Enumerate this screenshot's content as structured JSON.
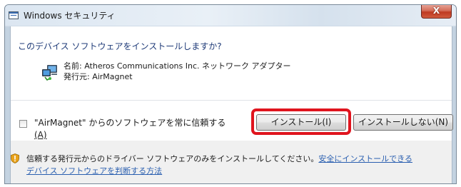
{
  "window": {
    "title": "Windows セキュリティ",
    "close_glyph": "X"
  },
  "prompt": "このデバイス ソフトウェアをインストールしますか?",
  "details": {
    "name": "名前: Atheros Communications Inc. ネットワーク アダプター",
    "publisher": "発行元: AirMagnet"
  },
  "trust": {
    "checked": false,
    "label_main": "\"AirMagnet\" からのソフトウェアを常に信頼する",
    "label_access": "(A)"
  },
  "buttons": {
    "install": "インストール(I)",
    "dont_install": "インストールしない(N)"
  },
  "warning": {
    "text": "信頼する発行元からのドライバー ソフトウェアのみをインストールしてください。",
    "link_part1": "安全にインストールできる",
    "link_part2": "デバイス ソフトウェアを判断する方法"
  },
  "colors": {
    "prompt_text": "#1f3b78",
    "link": "#2a5fb0",
    "highlight": "#e0141e",
    "close_button": "#c9452d"
  },
  "icons": {
    "title": "window-icon",
    "app": "network-adapter-icon",
    "warning": "shield-warning-icon"
  }
}
